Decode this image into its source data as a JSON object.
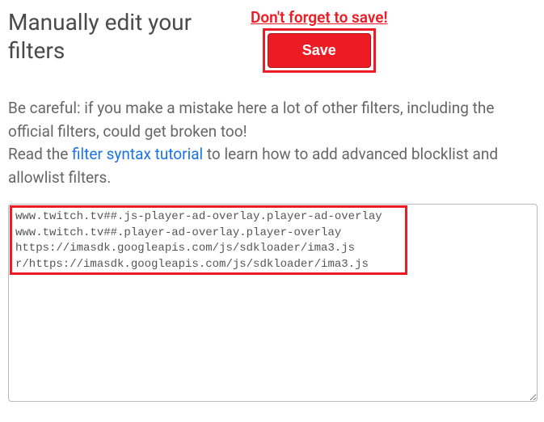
{
  "heading": "Manually edit your filters",
  "save_reminder": "Don't forget to save!",
  "save_label": "Save",
  "description": {
    "warning": "Be careful: if you make a mistake here a lot of other filters, including the official filters, could get broken too!",
    "read_prefix": "Read the ",
    "link_text": "filter syntax tutorial",
    "read_suffix": " to learn how to add advanced blocklist and allowlist filters."
  },
  "filters_text": "www.twitch.tv##.js-player-ad-overlay.player-ad-overlay\nwww.twitch.tv##.player-ad-overlay.player-overlay\nhttps://imasdk.googleapis.com/js/sdkloader/ima3.js\nr/https://imasdk.googleapis.com/js/sdkloader/ima3.js"
}
